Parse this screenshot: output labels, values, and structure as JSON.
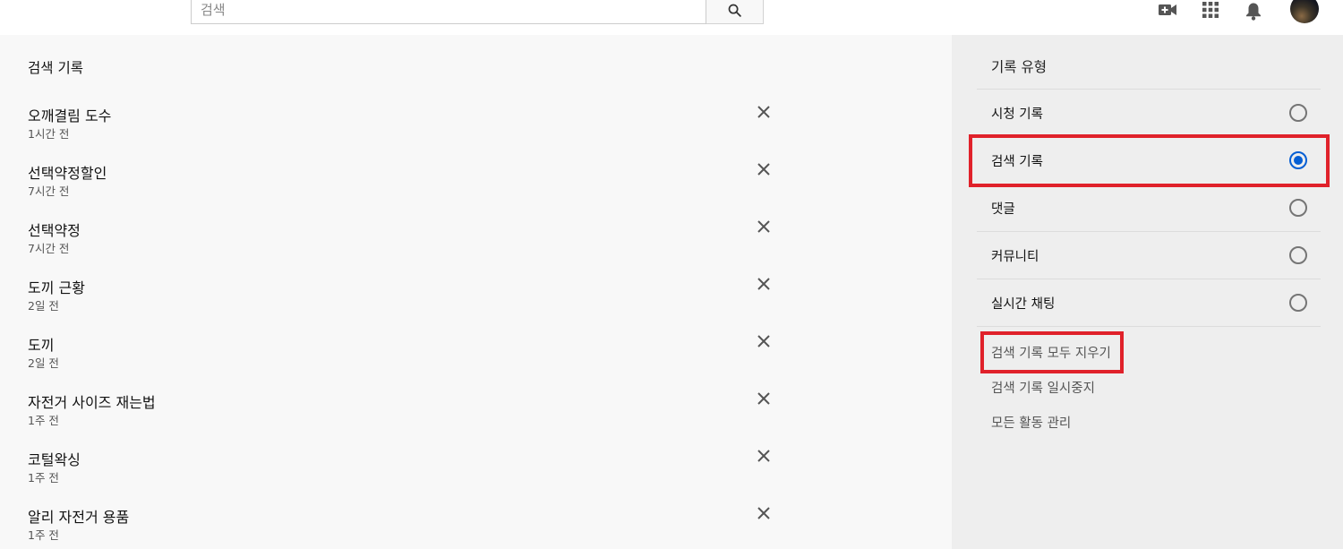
{
  "header": {
    "search_placeholder": "검색",
    "icons": [
      "search-icon",
      "video-camera-plus-icon",
      "apps-grid-icon",
      "bell-icon",
      "avatar"
    ]
  },
  "main": {
    "title": "검색 기록",
    "items": [
      {
        "query": "오깨결림 도수",
        "time": "1시간 전"
      },
      {
        "query": "선택약정할인",
        "time": "7시간 전"
      },
      {
        "query": "선택약정",
        "time": "7시간 전"
      },
      {
        "query": "도끼 근황",
        "time": "2일 전"
      },
      {
        "query": "도끼",
        "time": "2일 전"
      },
      {
        "query": "자전거 사이즈 재는법",
        "time": "1주 전"
      },
      {
        "query": "코털왁싱",
        "time": "1주 전"
      },
      {
        "query": "알리 자전거 용품",
        "time": "1주 전"
      }
    ]
  },
  "sidebar": {
    "title": "기록 유형",
    "types": [
      {
        "label": "시청 기록",
        "selected": false
      },
      {
        "label": "검색 기록",
        "selected": true
      },
      {
        "label": "댓글",
        "selected": false
      },
      {
        "label": "커뮤니티",
        "selected": false
      },
      {
        "label": "실시간 채팅",
        "selected": false
      }
    ],
    "actions": [
      {
        "label": "검색 기록 모두 지우기"
      },
      {
        "label": "검색 기록 일시중지"
      },
      {
        "label": "모든 활동 관리"
      }
    ]
  },
  "colors": {
    "accent": "#065fd4",
    "highlight": "#e0212a"
  }
}
